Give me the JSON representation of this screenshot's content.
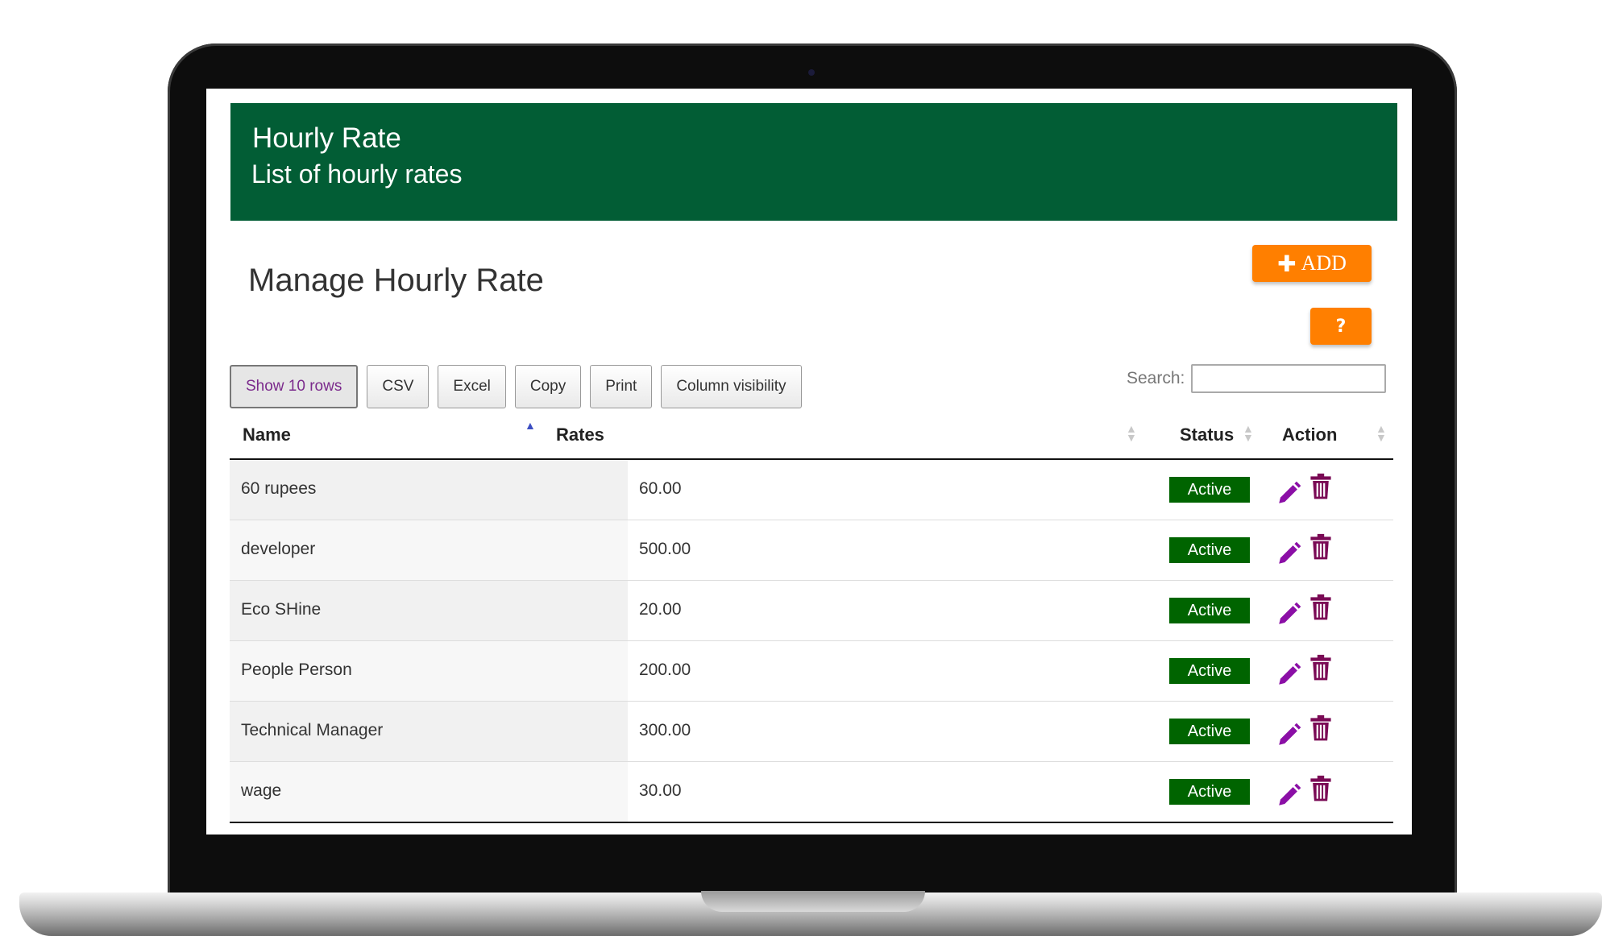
{
  "header": {
    "title": "Hourly Rate",
    "subtitle": "List of hourly rates"
  },
  "page": {
    "title": "Manage Hourly Rate"
  },
  "actions": {
    "add_label": "ADD",
    "help_label": "?"
  },
  "toolbar": {
    "buttons": [
      "Show 10 rows",
      "CSV",
      "Excel",
      "Copy",
      "Print",
      "Column visibility"
    ]
  },
  "search": {
    "label": "Search:",
    "value": ""
  },
  "table": {
    "columns": [
      "Name",
      "Rates",
      "Status",
      "Action"
    ],
    "rows": [
      {
        "name": "60 rupees",
        "rate": "60.00",
        "status": "Active"
      },
      {
        "name": "developer",
        "rate": "500.00",
        "status": "Active"
      },
      {
        "name": "Eco SHine",
        "rate": "20.00",
        "status": "Active"
      },
      {
        "name": "People Person",
        "rate": "200.00",
        "status": "Active"
      },
      {
        "name": "Technical Manager",
        "rate": "300.00",
        "status": "Active"
      },
      {
        "name": "wage",
        "rate": "30.00",
        "status": "Active"
      }
    ]
  },
  "colors": {
    "header_bg": "#025d35",
    "accent_orange": "#ff7f00",
    "status_green": "#006400",
    "action_purple": "#8b0fa6"
  },
  "icons": [
    "plus-icon",
    "question-icon",
    "sort-asc-icon",
    "sort-icon",
    "edit-icon",
    "trash-icon"
  ]
}
